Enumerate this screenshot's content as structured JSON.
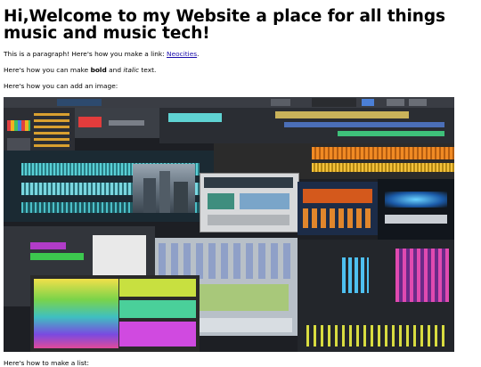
{
  "heading": "Hi,Welcome to my Website a place for all things music and music tech!",
  "paragraph1": {
    "before_link": "This is a paragraph! Here's how you make a link: ",
    "link_text": "Neocities",
    "after_link": "."
  },
  "paragraph2": {
    "before_bold": "Here's how you can make ",
    "bold_text": "bold",
    "middle": " and ",
    "italic_text": "italic",
    "after_italic": " text."
  },
  "paragraph3": "Here's how you can add an image:",
  "image": {
    "alt": "Collage of music production software (DAW) screenshots"
  },
  "paragraph4": "Here's how to make a list:",
  "colors": {
    "link": "#1a0dab",
    "daw_background": "#1d1f24"
  }
}
